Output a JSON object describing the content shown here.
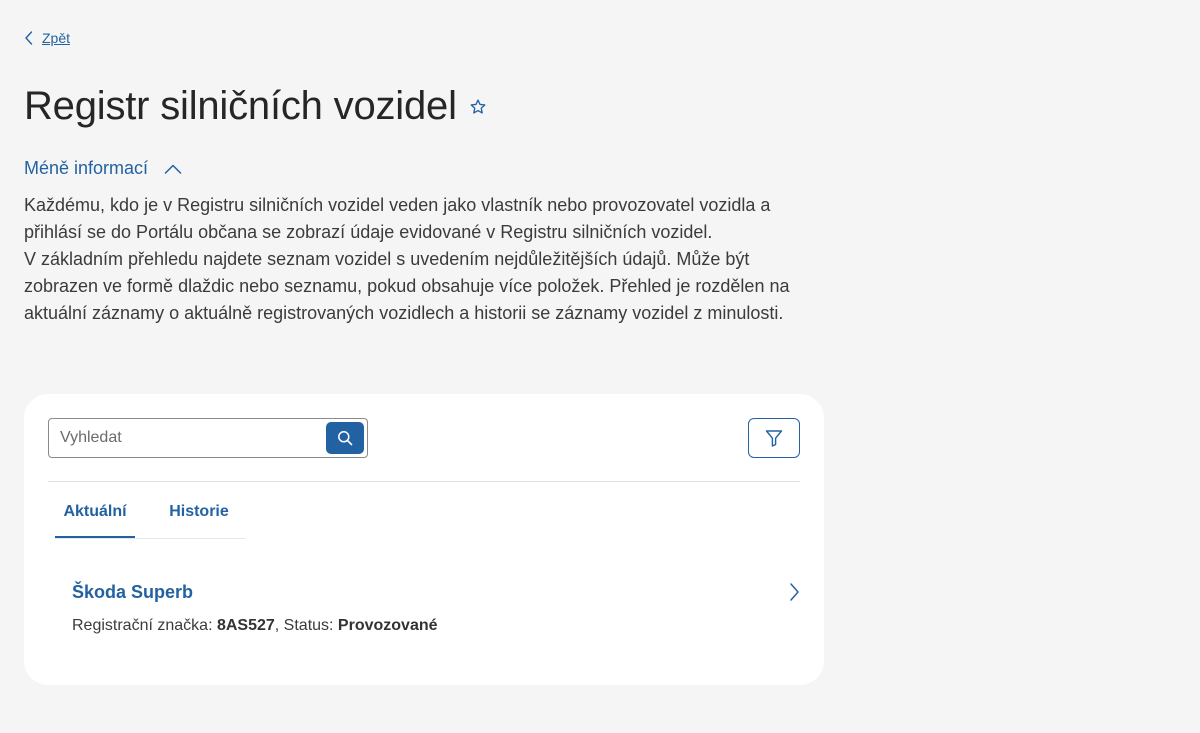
{
  "nav": {
    "back_label": "Zpět"
  },
  "page": {
    "title": "Registr silničních vozidel",
    "toggle_label": "Méně informací",
    "description": [
      "Každému, kdo je v Registru silničních vozidel veden jako vlastník nebo provozovatel vozidla a přihlásí se do Portálu občana se zobrazí údaje evidované v Registru silničních vozidel.",
      "V základním přehledu najdete seznam vozidel s uvedením nejdůležitějších údajů. Může být zobrazen ve formě dlaždic nebo seznamu, pokud obsahuje více položek. Přehled je rozdělen na aktuální záznamy o aktuálně registrovaných vozidlech a historii se záznamy vozidel z minulosti."
    ]
  },
  "search": {
    "placeholder": "Vyhledat",
    "value": ""
  },
  "tabs": [
    {
      "label": "Aktuální",
      "active": true
    },
    {
      "label": "Historie",
      "active": false
    }
  ],
  "vehicles": [
    {
      "name": "Škoda Superb",
      "plate_label": "Registrační značka: ",
      "plate": "8AS527",
      "status_label": ", Status: ",
      "status": "Provozované"
    }
  ],
  "icons": {
    "back": "chevron-left-icon",
    "favorite": "star-icon",
    "toggle": "chevron-up-icon",
    "search": "search-icon",
    "filter": "filter-icon",
    "open": "chevron-right-icon"
  },
  "colors": {
    "accent": "#2362a2",
    "background": "#f5f5f5",
    "card": "#ffffff",
    "text": "#3b3b3b"
  }
}
